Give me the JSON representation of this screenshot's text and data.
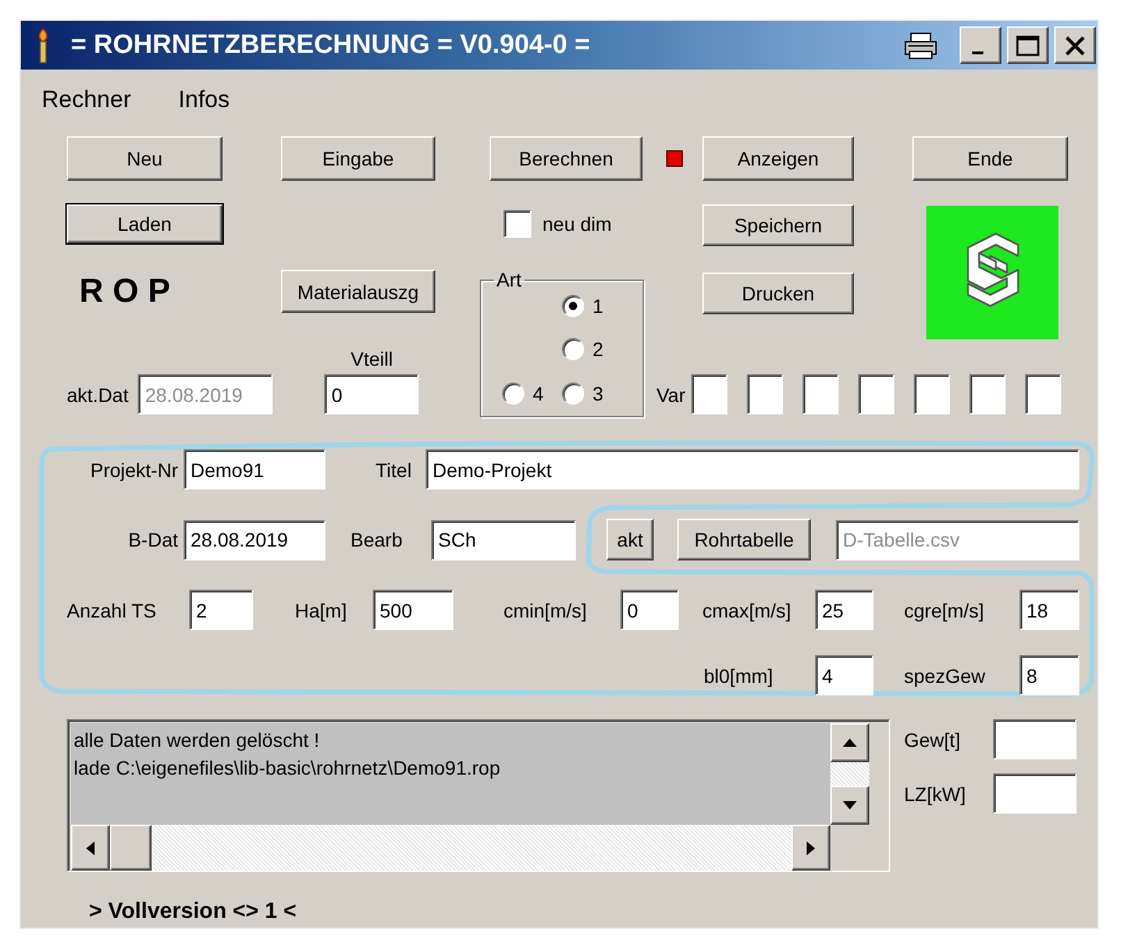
{
  "window": {
    "title": "= ROHRNETZBERECHNUNG = V0.904-0 ="
  },
  "menu": [
    {
      "label": "Rechner"
    },
    {
      "label": "Infos"
    }
  ],
  "top_buttons": [
    {
      "label": "Neu"
    },
    {
      "label": "Eingabe"
    },
    {
      "label": "Berechnen"
    },
    {
      "label": "Anzeigen"
    },
    {
      "label": "Ende"
    }
  ],
  "buttons": {
    "laden": "Laden",
    "speichern": "Speichern",
    "materialauszug": "Materialauszg",
    "drucken": "Drucken"
  },
  "neu_dim": {
    "label": "neu dim",
    "checked": false
  },
  "app_label": "R O P",
  "art": {
    "title": "Art",
    "options": [
      {
        "label": "1",
        "selected": true
      },
      {
        "label": "2",
        "selected": false
      },
      {
        "label": "4",
        "selected": false
      },
      {
        "label": "3",
        "selected": false
      }
    ]
  },
  "akt_dat": {
    "label": "akt.Dat",
    "value": "28.08.2019",
    "disabled": true
  },
  "vteill": {
    "label": "Vteill",
    "value": "0"
  },
  "var": {
    "label": "Var"
  },
  "projekt": {
    "nr_label": "Projekt-Nr",
    "nr": "Demo91",
    "titel_label": "Titel",
    "titel": "Demo-Projekt"
  },
  "bearbeitung": {
    "bdat_label": "B-Dat",
    "bdat": "28.08.2019",
    "bearb_label": "Bearb",
    "bearb": "SCh",
    "akt_button": "akt",
    "rohrtabelle_button": "Rohrtabelle",
    "tabelle": {
      "value": "D-Tabelle.csv",
      "disabled": true
    }
  },
  "parameters": [
    {
      "label": "Anzahl TS",
      "value": "2"
    },
    {
      "label": "Ha[m]",
      "value": "500"
    },
    {
      "label": "cmin[m/s]",
      "value": "0"
    },
    {
      "label": "cmax[m/s]",
      "value": "25"
    },
    {
      "label": "cgre[m/s]",
      "value": "18"
    },
    {
      "label": "bl0[mm]",
      "value": "4"
    },
    {
      "label": "spezGew",
      "value": "8"
    }
  ],
  "log": {
    "lines": [
      "alle Daten werden gelöscht !",
      "lade C:\\eigenefiles\\lib-basic\\rohrnetz\\Demo91.rop"
    ]
  },
  "results": [
    {
      "label": "Gew[t]"
    },
    {
      "label": "LZ[kW]"
    }
  ],
  "footer": "> Vollversion <> 1 <"
}
